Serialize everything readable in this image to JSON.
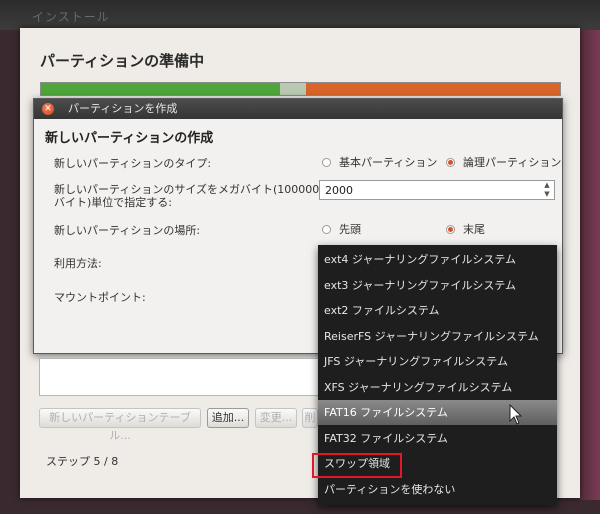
{
  "window": {
    "title": "インストール"
  },
  "installer": {
    "heading": "パーティションの準備中",
    "partition_colors": [
      "#4fa63a",
      "#b9c9b2",
      "#d9652b"
    ],
    "partition_fractions": [
      0.46,
      0.05,
      0.49
    ]
  },
  "dialog": {
    "title": "パーティションを作成",
    "heading": "新しいパーティションの作成",
    "type_label": "新しいパーティションのタイプ:",
    "type_primary": "基本パーティション",
    "type_logical": "論理パーティション",
    "type_selected": "logical",
    "size_label_line1": "新しいパーティションのサイズをメガバイト(1000000",
    "size_label_line2": "バイト)単位で指定する:",
    "size_value": "2000",
    "location_label": "新しいパーティションの場所:",
    "location_start": "先頭",
    "location_end": "末尾",
    "location_selected": "end",
    "use_as_label": "利用方法:",
    "mount_label": "マウントポイント:"
  },
  "buttons": {
    "new_table": "新しいパーティションテーブル...",
    "add": "追加...",
    "change": "変更...",
    "delete": "削除"
  },
  "step": "ステップ 5 / 8",
  "dropdown": {
    "items": [
      "ext4 ジャーナリングファイルシステム",
      "ext3 ジャーナリングファイルシステム",
      "ext2 ファイルシステム",
      "ReiserFS ジャーナリングファイルシステム",
      "JFS ジャーナリングファイルシステム",
      "XFS ジャーナリングファイルシステム",
      "FAT16 ファイルシステム",
      "FAT32 ファイルシステム",
      "スワップ領域",
      "パーティションを使わない"
    ],
    "hover_index": 6,
    "annotated_index": 8,
    "annotation_color": "#e0182a"
  },
  "colors": {
    "accent": "#d8522c",
    "menu_bg": "#1e1e1e"
  }
}
